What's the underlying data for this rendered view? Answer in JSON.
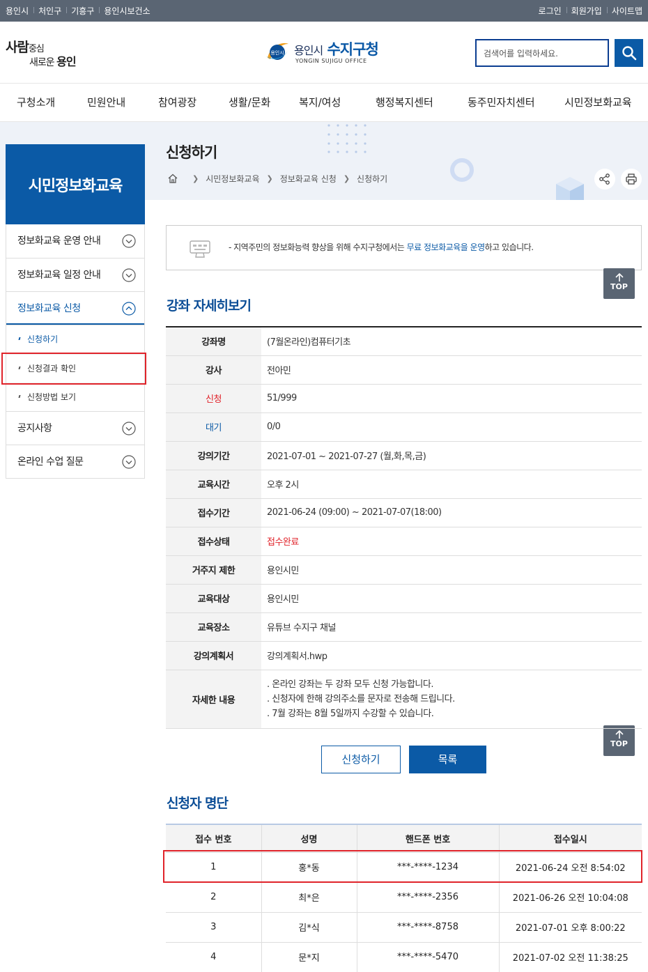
{
  "topbar": {
    "left": [
      "용인시",
      "처인구",
      "기흥구",
      "용인시보건소"
    ],
    "right": [
      "로그인",
      "회원가입",
      "사이트맵"
    ]
  },
  "header": {
    "slogan_line1a": "사람",
    "slogan_line1b": "중심",
    "slogan_line2a": "새로운",
    "slogan_line2b": "용인",
    "logo_emblem_text": "용인시",
    "logo_city": "용인시",
    "logo_office": "수지구청",
    "logo_eng": "YONGIN SUJIGU OFFICE",
    "search_placeholder": "검색어를 입력하세요."
  },
  "gnb": [
    "구청소개",
    "민원안내",
    "참여광장",
    "생활/문화",
    "복지/여성",
    "행정복지센터",
    "동주민자치센터",
    "시민정보화교육"
  ],
  "side": {
    "title": "시민정보화교육",
    "menu1": "정보화교육 운영 안내",
    "menu2": "정보화교육 일정 안내",
    "menu3": "정보화교육 신청",
    "sub1": "신청하기",
    "sub2": "신청결과 확인",
    "sub3": "신청방법 보기",
    "menu4": "공지사항",
    "menu5": "온라인 수업 질문"
  },
  "page": {
    "title": "신청하기",
    "breadcrumb": [
      "시민정보화교육",
      "정보화교육 신청",
      "신청하기"
    ]
  },
  "notice": {
    "prefix": "- 지역주민의 정보화능력 향상을 위해 수지구청에서는 ",
    "highlight": "무료 정보화교육을 운영",
    "suffix": "하고 있습니다."
  },
  "top_label": "TOP",
  "detail": {
    "title": "강좌 자세히보기",
    "rows": [
      {
        "label": "강좌명",
        "value": "(7월온라인)컴퓨터기초"
      },
      {
        "label": "강사",
        "value": "전아민"
      },
      {
        "label": "신청",
        "value": "51/999"
      },
      {
        "label": "대기",
        "value": "0/0"
      },
      {
        "label": "강의기간",
        "value": "2021-07-01 ~ 2021-07-27 (월,화,목,금)"
      },
      {
        "label": "교육시간",
        "value": "오후 2시"
      },
      {
        "label": "접수기간",
        "value": "2021-06-24 (09:00) ~ 2021-07-07(18:00)"
      },
      {
        "label": "접수상태",
        "value": "접수완료"
      },
      {
        "label": "거주지 제한",
        "value": "용인시민"
      },
      {
        "label": "교육대상",
        "value": "용인시민"
      },
      {
        "label": "교육장소",
        "value": "유튜브 수지구 채널"
      },
      {
        "label": "강의계획서",
        "value": "강의계획서.hwp"
      },
      {
        "label": "자세한 내용",
        "lines": [
          ". 온라인 강좌는 두 강좌 모두 신청 가능합니다.",
          ". 신청자에 한해 강의주소를 문자로 전송해 드립니다.",
          ". 7월 강좌는 8월 5일까지 수강할 수 있습니다."
        ]
      }
    ]
  },
  "buttons": {
    "apply": "신청하기",
    "list": "목록"
  },
  "applicants": {
    "title": "신청자 명단",
    "headers": [
      "접수 번호",
      "성명",
      "핸드폰 번호",
      "접수일시"
    ],
    "rows": [
      [
        "1",
        "홍*동",
        "***-****-1234",
        "2021-06-24 오전 8:54:02"
      ],
      [
        "2",
        "최*은",
        "***-****-2356",
        "2021-06-26 오전 10:04:08"
      ],
      [
        "3",
        "김*식",
        "***-****-8758",
        "2021-07-01 오후 8:00:22"
      ],
      [
        "4",
        "문*지",
        "***-****-5470",
        "2021-07-02 오전 11:38:25"
      ]
    ]
  },
  "colors": {
    "primary": "#0b5aa6",
    "dark": "#5a6573",
    "highlight": "#e0232a"
  }
}
